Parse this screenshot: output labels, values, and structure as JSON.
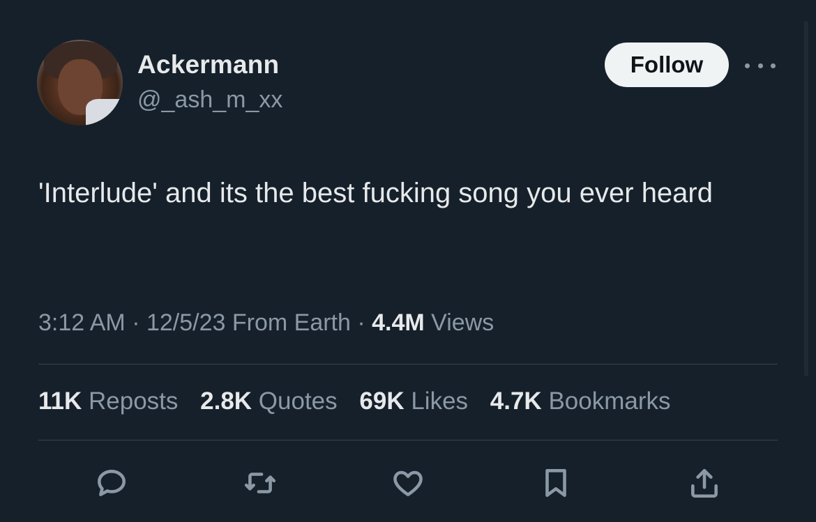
{
  "author": {
    "display_name": "Ackermann",
    "handle": "@_ash_m_xx"
  },
  "header": {
    "follow_label": "Follow",
    "more_icon": "more-horizontal-icon"
  },
  "tweet": {
    "text": "'Interlude' and its the best fucking song you ever heard"
  },
  "meta": {
    "time": "3:12 AM",
    "separator1": " · ",
    "date": "12/5/23",
    "location": " From Earth",
    "separator2": " · ",
    "views_count": "4.4M",
    "views_label": " Views"
  },
  "stats": [
    {
      "count": "11K",
      "label": " Reposts"
    },
    {
      "count": "2.8K",
      "label": " Quotes"
    },
    {
      "count": "69K",
      "label": " Likes"
    },
    {
      "count": "4.7K",
      "label": " Bookmarks"
    }
  ],
  "actions": {
    "reply_icon": "reply-icon",
    "repost_icon": "repost-icon",
    "like_icon": "heart-icon",
    "bookmark_icon": "bookmark-icon",
    "share_icon": "share-icon"
  },
  "colors": {
    "background": "#15202b",
    "text_primary": "#e7e9ea",
    "text_secondary": "#8b98a5",
    "divider": "#38444d",
    "follow_button_bg": "#eff3f4"
  }
}
